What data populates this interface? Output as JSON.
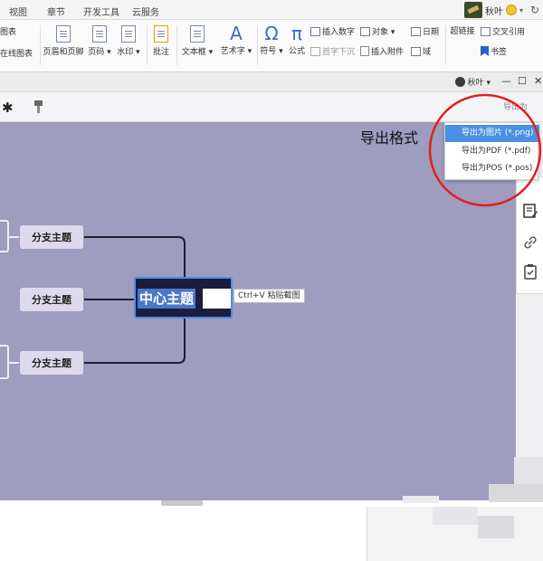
{
  "menu": {
    "items": [
      "视图",
      "章节",
      "开发工具",
      "云服务"
    ],
    "user_name": "秋叶"
  },
  "ribbon": {
    "left_top": "图表",
    "left_bottom": "在线图表",
    "header_footer": "页眉和页脚",
    "page_number": "页码 ▾",
    "watermark": "水印 ▾",
    "comment": "批注",
    "textbox": "文本框 ▾",
    "wordart": "艺术字 ▾",
    "symbol": "符号 ▾",
    "formula": "公式",
    "insert_number": "插入数字",
    "drop_cap": "首字下沉",
    "object": "对象 ▾",
    "insert_attachment": "插入附件",
    "date": "日期",
    "field": "域",
    "hyperlink": "超链接",
    "cross_reference": "交叉引用",
    "bookmark": "书签"
  },
  "window": {
    "user_name": "秋叶 ▾"
  },
  "toolbar": {
    "export_label": "导出为"
  },
  "canvas": {
    "annotation": "导出格式",
    "central_topic": "中心主题",
    "paste_hint": "Ctrl+V 粘贴截图",
    "branches": [
      "分支主题",
      "分支主题",
      "分支主题"
    ]
  },
  "export_menu": {
    "items": [
      "导出为图片 (*.png)",
      "导出为PDF (*.pdf)",
      "导出为POS (*.pos)"
    ]
  },
  "colors": {
    "canvas": "#9e9cbf",
    "branch_node": "#ded9ec",
    "central_node": "#1c1c3d",
    "selection": "#4a90e2",
    "highlight_circle": "#e02020"
  }
}
